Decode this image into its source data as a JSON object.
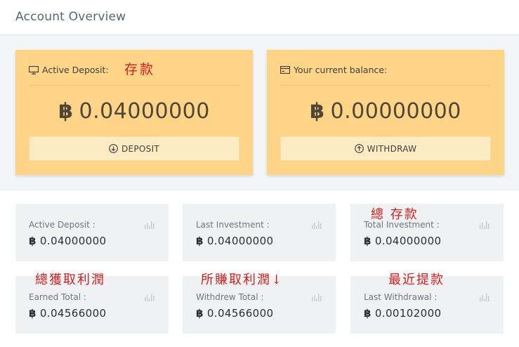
{
  "header": {
    "title": "Account Overview"
  },
  "cards": [
    {
      "label": "Active Deposit:",
      "annotation": "存款",
      "amount": "0.04000000",
      "currency_symbol": "฿",
      "button_label": "DEPOSIT",
      "icon": "monitor-icon",
      "button_icon": "arrow-down-circle-icon"
    },
    {
      "label": "Your current balance:",
      "amount": "0.00000000",
      "currency_symbol": "฿",
      "button_label": "WITHDRAW",
      "icon": "wallet-icon",
      "button_icon": "arrow-up-circle-icon"
    }
  ],
  "stats": [
    {
      "label": "Active Deposit :",
      "value": "0.04000000",
      "currency_symbol": "฿"
    },
    {
      "label": "Last Investment :",
      "value": "0.04000000",
      "currency_symbol": "฿"
    },
    {
      "label": "Total Investment :",
      "value": "0.04000000",
      "currency_symbol": "฿",
      "annotation": "總 存款"
    },
    {
      "label": "Earned Total :",
      "value": "0.04566000",
      "currency_symbol": "฿",
      "annotation": "總獲取利潤"
    },
    {
      "label": "Withdrew Total :",
      "value": "0.04566000",
      "currency_symbol": "฿",
      "annotation": "所賺取利潤↓"
    },
    {
      "label": "Last Withdrawal :",
      "value": "0.00102000",
      "currency_symbol": "฿",
      "annotation": "最近提款"
    }
  ],
  "colors": {
    "card_bg": "#fdd488",
    "button_bg": "#fdebc3",
    "annotation": "#d02020",
    "stat_bg": "#f0f1f3"
  }
}
